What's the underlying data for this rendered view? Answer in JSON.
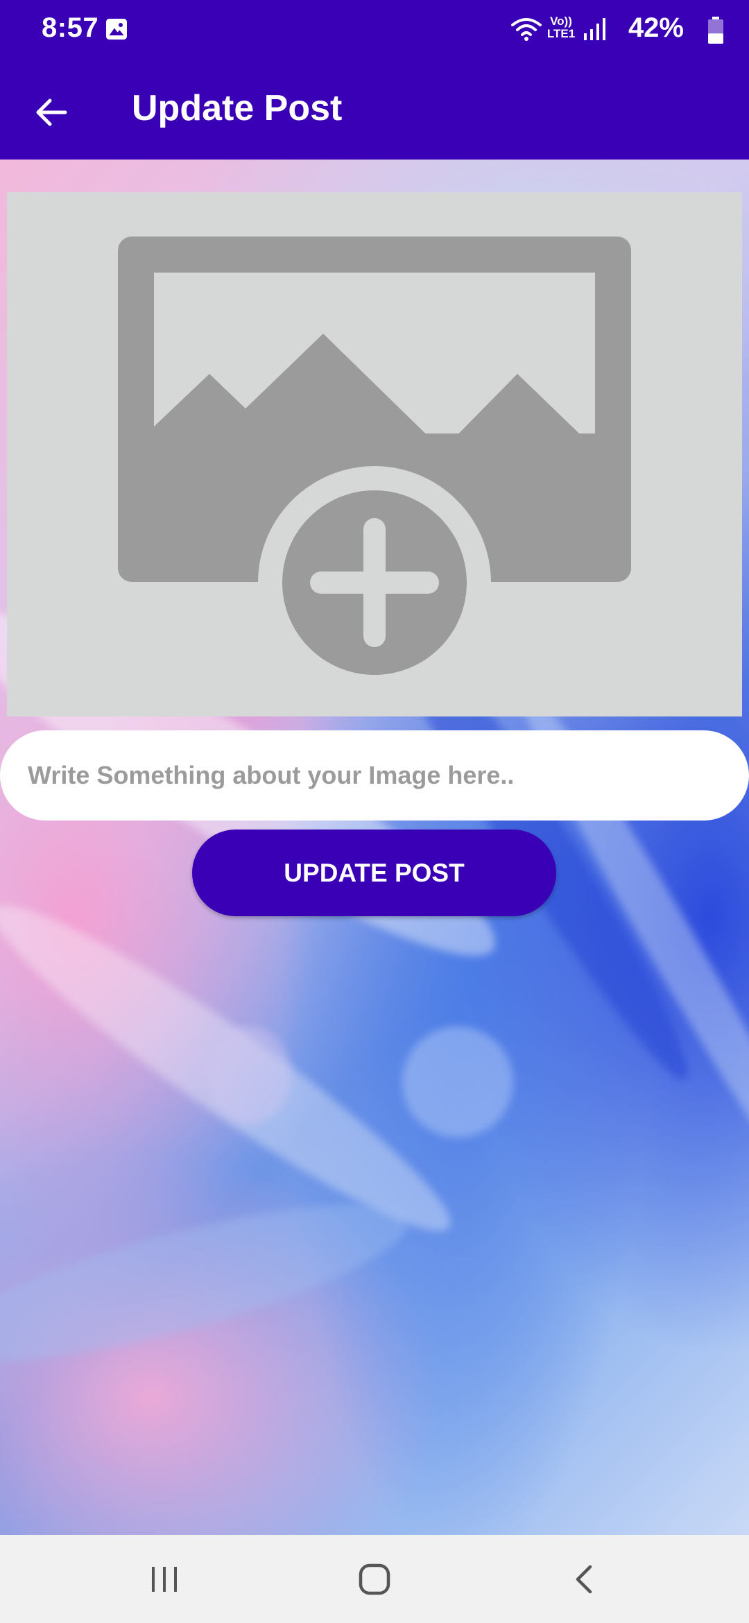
{
  "status_bar": {
    "time": "8:57",
    "network_label_top": "Vo))",
    "network_label_bottom": "LTE1",
    "battery_percent": "42%",
    "battery_level": 0.42,
    "icons": [
      "image-notification-icon",
      "wifi-icon",
      "signal-icon",
      "battery-icon"
    ]
  },
  "app_bar": {
    "title": "Update Post",
    "back_icon": "arrow-back-icon",
    "color": "#3a00b5"
  },
  "image_picker": {
    "icon": "add-photo-icon",
    "background_color": "#d6d7d7",
    "icon_color": "#9b9b9b"
  },
  "caption": {
    "placeholder": "Write Something about your Image here..",
    "value": ""
  },
  "update_button": {
    "label": "UPDATE POST",
    "color": "#3a00b5"
  },
  "nav_bar": {
    "items": [
      "recent-apps-icon",
      "home-icon",
      "back-icon"
    ]
  }
}
